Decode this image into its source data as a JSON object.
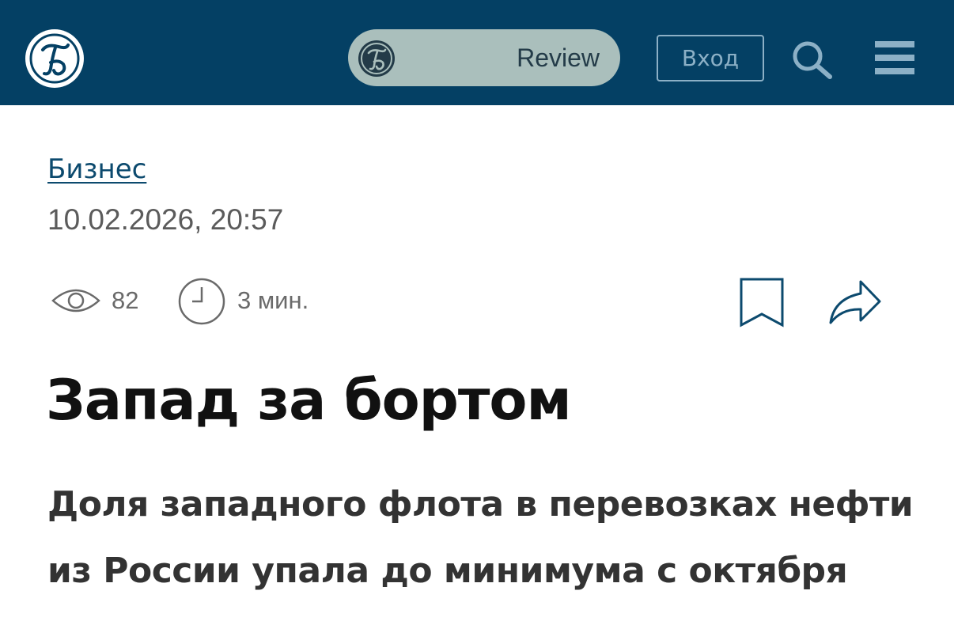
{
  "header": {
    "logo_icon": "publication-monogram-logo",
    "review_label": "Review",
    "login_label": "Вход",
    "search_icon": "search-icon",
    "menu_icon": "hamburger-menu-icon",
    "colors": {
      "background": "#044064",
      "pill": "#aabfbc",
      "login_text": "#8cb0c6"
    }
  },
  "article": {
    "category": "Бизнес",
    "datetime": "10.02.2026, 20:57",
    "views": "82",
    "read_time": "3 мин.",
    "title": "Запад за бортом",
    "subtitle_lines": [
      "Доля западного флота в перевозках нефти",
      "из России упала до минимума с октября"
    ]
  },
  "colors": {
    "link": "#0c4a6e",
    "icon_stroke": "#0c4a6e",
    "meta_text": "#6a6a6a"
  }
}
